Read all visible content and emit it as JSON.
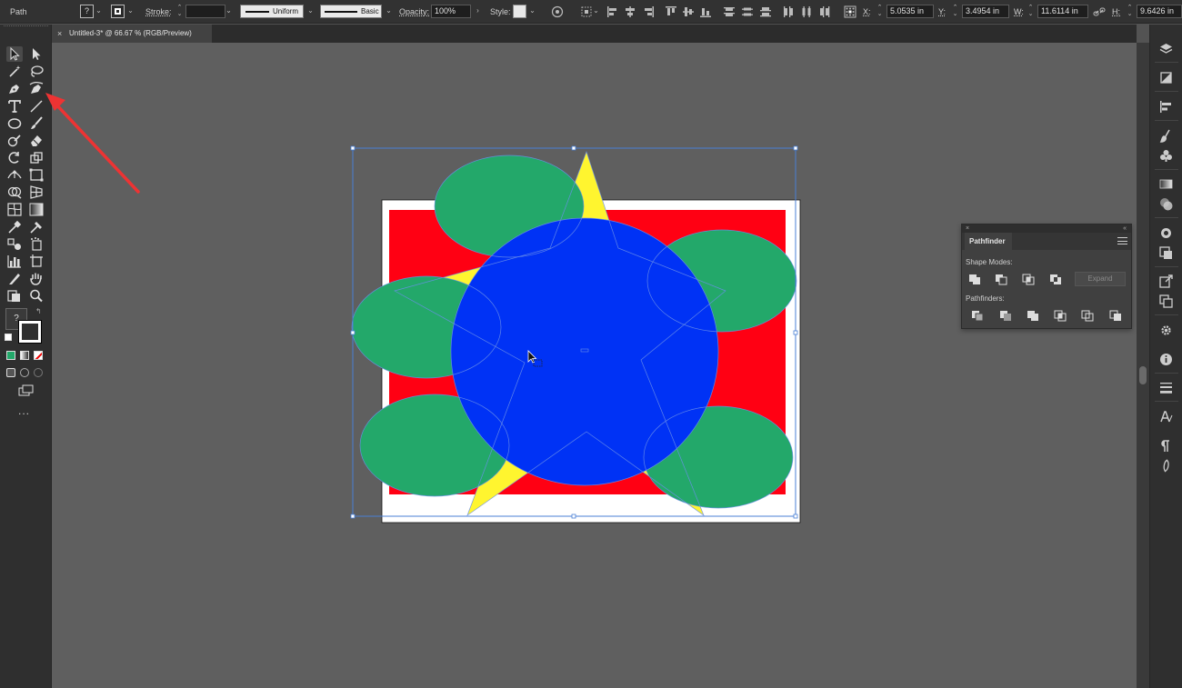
{
  "control_bar": {
    "selection_type": "Path",
    "fill_tooltip": "?",
    "stroke_label": "Stroke:",
    "stroke_weight": "",
    "stroke_profile": "Uniform",
    "brush": "Basic",
    "opacity_label": "Opacity:",
    "opacity_value": "100%",
    "style_label": "Style:",
    "x_label": "X:",
    "x_value": "5.0535 in",
    "y_label": "Y:",
    "y_value": "3.4954 in",
    "w_label": "W:",
    "w_value": "11.6114 in",
    "h_label": "H:",
    "h_value": "9.6426 in"
  },
  "document_tab": {
    "close": "×",
    "title": "Untitled-3* @ 66.67 % (RGB/Preview)"
  },
  "toolbar": {
    "fill_stroke_tooltip": "?",
    "more_tools": "..."
  },
  "pathfinder": {
    "title": "Pathfinder",
    "close": "×",
    "collapse": "«",
    "shape_modes_label": "Shape Modes:",
    "pathfinders_label": "Pathfinders:",
    "expand_label": "Expand"
  },
  "artwork": {
    "background_color": "#ff0013",
    "circle_color": "#0032f5",
    "star_color": "#fff52f",
    "ellipse_color": "#23a86a",
    "artboard_color": "#ffffff",
    "selection_color": "#4a7fd6",
    "annotation_color": "#e33"
  }
}
